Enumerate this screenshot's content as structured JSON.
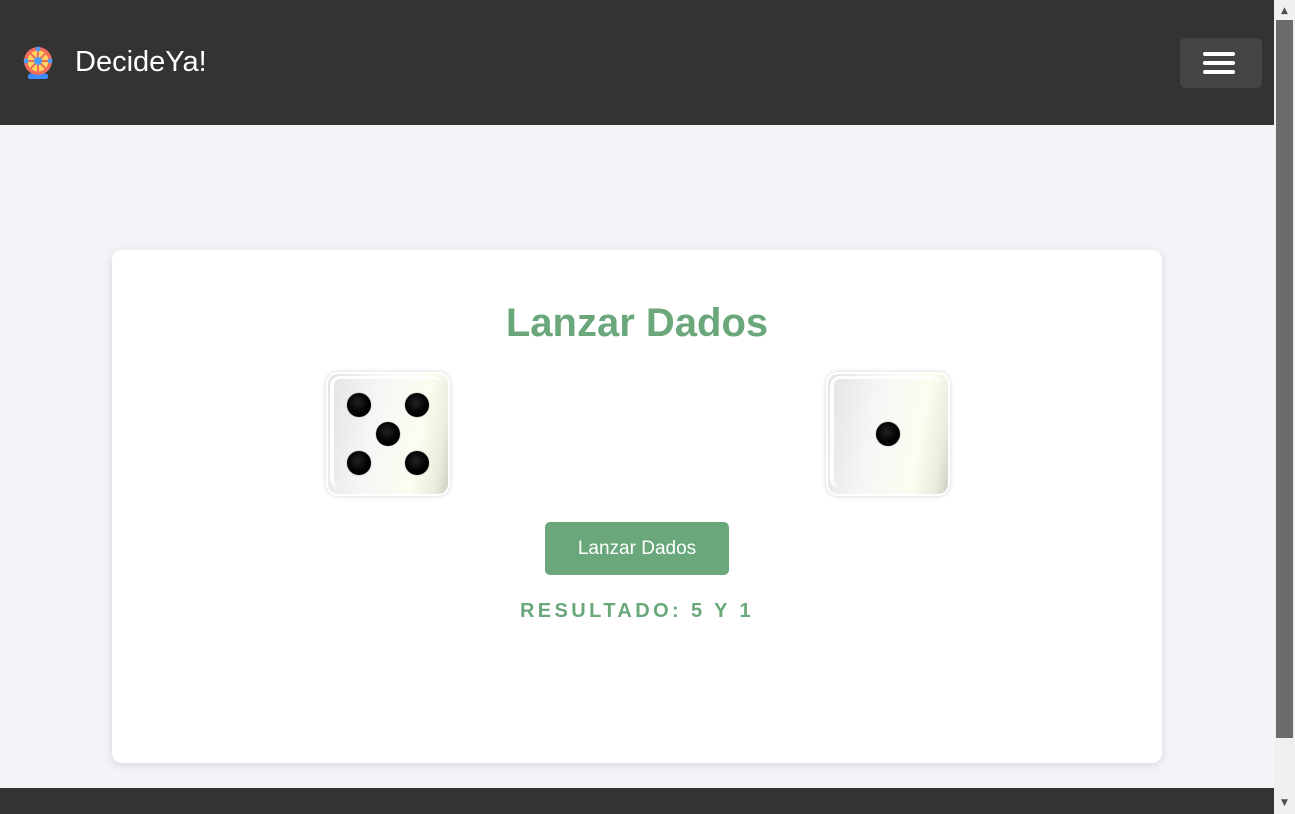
{
  "navbar": {
    "brand_name": "DecideYa!",
    "logo_icon": "ferris-wheel-icon",
    "menu_icon": "hamburger-menu-icon"
  },
  "card": {
    "title": "Lanzar Dados",
    "dice": [
      5,
      1
    ],
    "button_label": "Lanzar Dados",
    "result_text": "Resultado: 5 y 1"
  },
  "scrollbar": {
    "up_arrow": "▲",
    "down_arrow": "▼"
  },
  "colors": {
    "navbar_bg": "#333333",
    "accent_green": "#6aa87c",
    "page_bg": "#f4f4f8",
    "card_bg": "#ffffff"
  }
}
